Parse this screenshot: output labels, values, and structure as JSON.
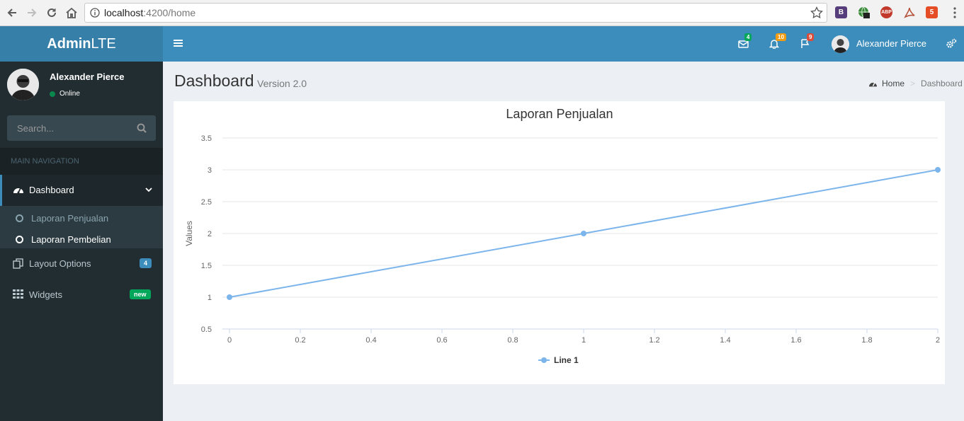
{
  "browser": {
    "url_host": "localhost",
    "url_path": ":4200/home",
    "extensions": [
      {
        "name": "bootstrap-ext",
        "label": "B",
        "color": "#563d7c"
      },
      {
        "name": "sg-ext",
        "label": "SG",
        "color": "#2d6a2d"
      },
      {
        "name": "abp-ext",
        "label": "ABP",
        "color": "#c0392b"
      },
      {
        "name": "pdf-ext",
        "label": "",
        "color": "#b5533c"
      },
      {
        "name": "html5-ext",
        "label": "5",
        "color": "#e44d26"
      }
    ]
  },
  "header": {
    "logo_bold": "Admin",
    "logo_light": "LTE",
    "messages_count": "4",
    "notifications_count": "10",
    "tasks_count": "9",
    "user_name": "Alexander Pierce",
    "colors": {
      "brand": "#3c8dbc",
      "brand_dark": "#367fa9",
      "green": "#00a65a",
      "yellow": "#f39c12",
      "red": "#dd4b39"
    }
  },
  "sidebar": {
    "user_name": "Alexander Pierce",
    "user_status": "Online",
    "search_placeholder": "Search...",
    "section_header": "MAIN NAVIGATION",
    "items": [
      {
        "label": "Dashboard",
        "icon": "dashboard-icon"
      },
      {
        "label": "Layout Options",
        "icon": "files-icon",
        "badge": "4"
      },
      {
        "label": "Widgets",
        "icon": "th-icon",
        "badge": "new"
      }
    ],
    "submenu": [
      {
        "label": "Laporan Penjualan"
      },
      {
        "label": "Laporan Pembelian"
      }
    ]
  },
  "content": {
    "title": "Dashboard",
    "subtitle": "Version 2.0",
    "breadcrumb": {
      "home": "Home",
      "current": "Dashboard"
    }
  },
  "chart_data": {
    "type": "line",
    "title": "Laporan Penjualan",
    "xlabel": "",
    "ylabel": "Values",
    "x": [
      0,
      1,
      2
    ],
    "series": [
      {
        "name": "Line 1",
        "values": [
          1,
          2,
          3
        ],
        "color": "#7cb5ec"
      }
    ],
    "xlim": [
      0,
      2
    ],
    "ylim": [
      0.5,
      3.5
    ],
    "xticks": [
      "0",
      "0.2",
      "0.4",
      "0.6",
      "0.8",
      "1",
      "1.2",
      "1.4",
      "1.6",
      "1.8",
      "2"
    ],
    "yticks": [
      "0.5",
      "1",
      "1.5",
      "2",
      "2.5",
      "3",
      "3.5"
    ],
    "grid": true,
    "legend": "bottom-center"
  }
}
